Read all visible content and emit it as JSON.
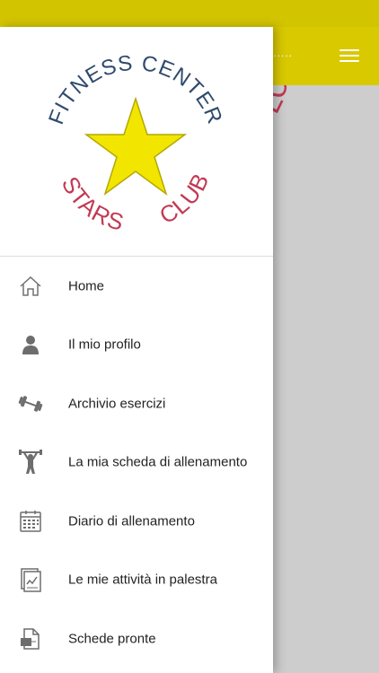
{
  "colors": {
    "accent": "#d9c900",
    "logo_blue": "#2f4a6d",
    "logo_red": "#c23a54",
    "star": "#f2e600"
  },
  "appbar": {
    "title_truncated": "......",
    "menu_icon": "hamburger-menu-icon"
  },
  "logo": {
    "top_text": "FITNESS CENTER",
    "bottom_left_text": "STARS",
    "bottom_right_text": "CLUB"
  },
  "nav": {
    "items": [
      {
        "label": "Home",
        "icon": "home-icon"
      },
      {
        "label": "Il mio profilo",
        "icon": "user-icon"
      },
      {
        "label": "Archivio esercizi",
        "icon": "dumbbell-icon"
      },
      {
        "label": "La mia scheda di allenamento",
        "icon": "weightlifter-icon"
      },
      {
        "label": "Diario di allenamento",
        "icon": "calendar-icon"
      },
      {
        "label": "Le mie attività in palestra",
        "icon": "activity-chart-icon"
      },
      {
        "label": "Schede pronte",
        "icon": "document-icon"
      }
    ]
  }
}
